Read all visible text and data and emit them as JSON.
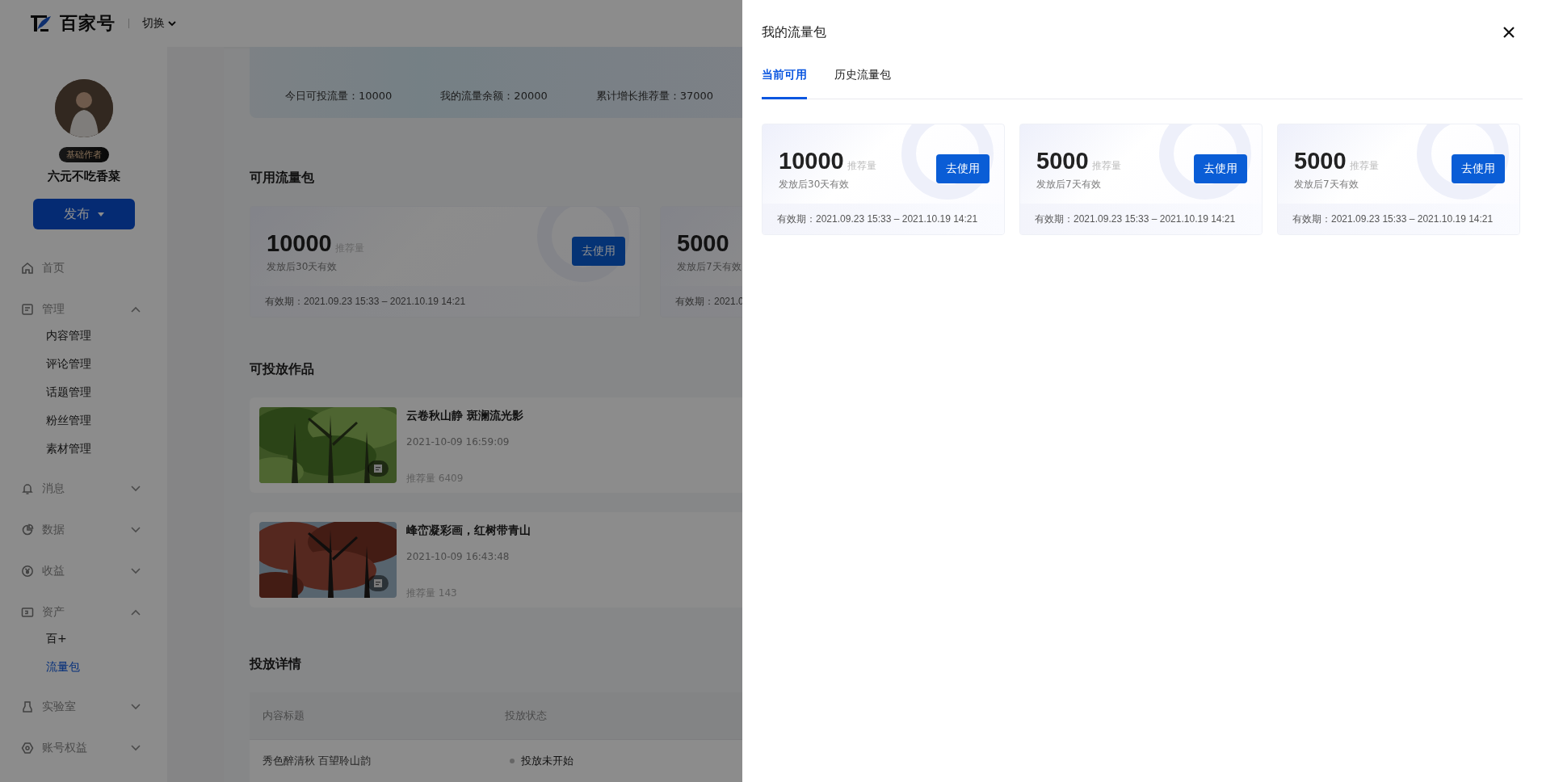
{
  "header": {
    "logo_text": "百家号",
    "switch_label": "切换"
  },
  "sidebar": {
    "badge": "基础作者",
    "username": "六元不吃香菜",
    "publish_button": "发布",
    "menu": [
      {
        "kind": "link",
        "label": "首页"
      },
      {
        "kind": "group",
        "label": "管理",
        "expanded": true,
        "children": [
          {
            "label": "内容管理",
            "selected": false
          },
          {
            "label": "评论管理",
            "selected": false
          },
          {
            "label": "话题管理",
            "selected": false
          },
          {
            "label": "粉丝管理",
            "selected": false
          },
          {
            "label": "素材管理",
            "selected": false
          }
        ]
      },
      {
        "kind": "group",
        "label": "消息",
        "expanded": false
      },
      {
        "kind": "group",
        "label": "数据",
        "expanded": false
      },
      {
        "kind": "group",
        "label": "收益",
        "expanded": false
      },
      {
        "kind": "group",
        "label": "资产",
        "expanded": true,
        "children": [
          {
            "label": "百+",
            "selected": false
          },
          {
            "label": "流量包",
            "selected": true
          }
        ]
      },
      {
        "kind": "group",
        "label": "实验室",
        "expanded": false
      },
      {
        "kind": "group",
        "label": "账号权益",
        "expanded": false
      }
    ]
  },
  "stats": [
    "今日可投流量：10000",
    "我的流量余额：20000",
    "累计增长推荐量：37000"
  ],
  "available_packages": {
    "title": "可用流量包",
    "cards": [
      {
        "amount": "10000",
        "unit": "推荐量",
        "note": "发放后30天有效",
        "validity": "有效期：2021.09.23 15:33 – 2021.10.19 14:21",
        "button": "去使用"
      },
      {
        "amount": "5000",
        "note": "发放后7天有效",
        "validity": "有效期：2021.0"
      }
    ]
  },
  "works": {
    "title": "可投放作品",
    "items": [
      {
        "title": "云卷秋山静 斑澜流光影",
        "date": "2021-10-09 16:59:09",
        "views": "推荐量 6409",
        "kind": "picture"
      },
      {
        "title": "峰峦凝彩画，红树带青山",
        "date": "2021-10-09 16:43:48",
        "views": "推荐量 143",
        "kind": "picture"
      }
    ]
  },
  "delivery": {
    "title": "投放详情",
    "columns": [
      "内容标题",
      "投放状态"
    ],
    "rows": [
      {
        "title": "秀色醉清秋 百望聆山韵",
        "status": "投放未开始"
      }
    ]
  },
  "drawer": {
    "title": "我的流量包",
    "tabs": [
      {
        "label": "当前可用",
        "selected": true
      },
      {
        "label": "历史流量包",
        "selected": false
      }
    ],
    "cards": [
      {
        "amount": "10000",
        "unit": "推荐量",
        "note": "发放后30天有效",
        "validity": "有效期：2021.09.23 15:33 – 2021.10.19 14:21",
        "button": "去使用"
      },
      {
        "amount": "5000",
        "unit": "推荐量",
        "note": "发放后7天有效",
        "validity": "有效期：2021.09.23 15:33 – 2021.10.19 14:21",
        "button": "去使用"
      },
      {
        "amount": "5000",
        "unit": "推荐量",
        "note": "发放后7天有效",
        "validity": "有效期：2021.09.23 15:33 – 2021.10.19 14:21",
        "button": "去使用"
      }
    ]
  }
}
